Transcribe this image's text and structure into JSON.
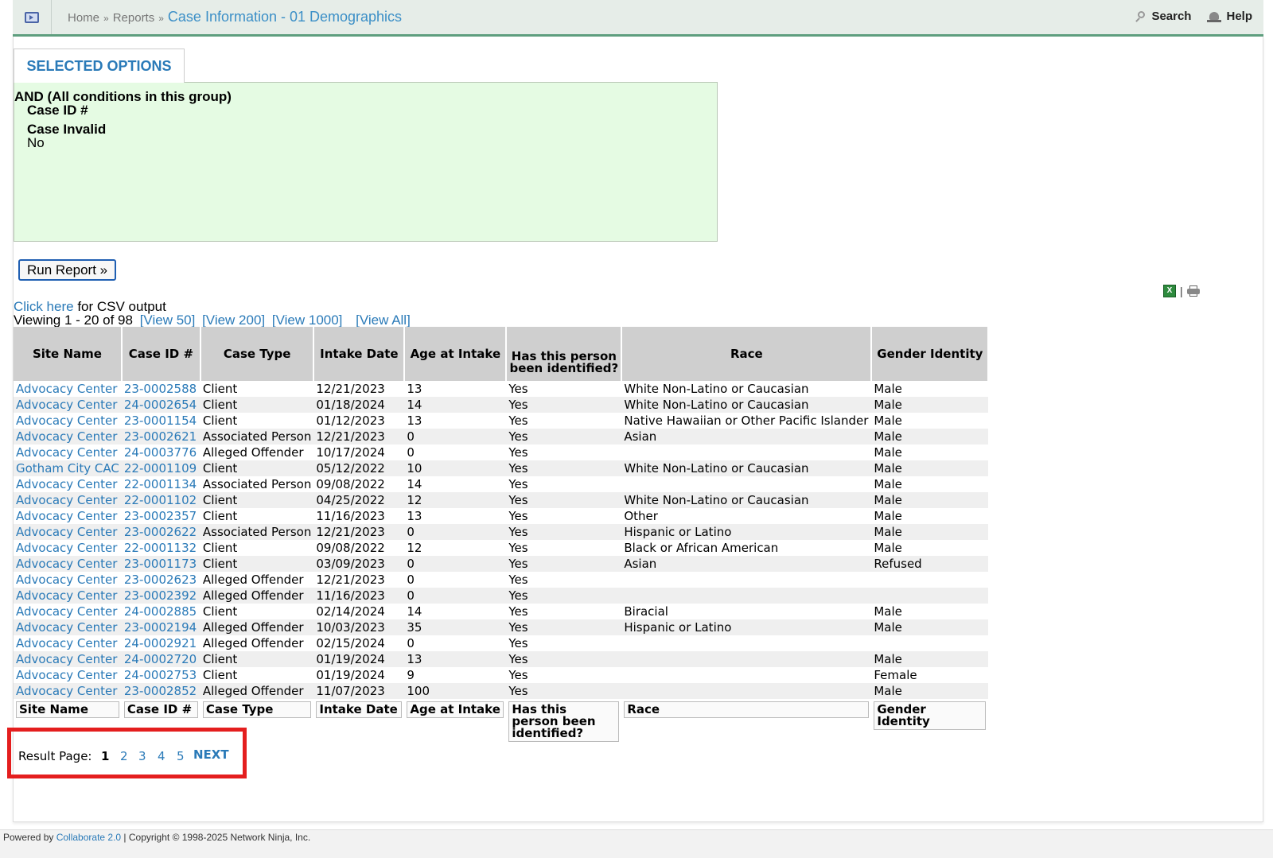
{
  "header": {
    "breadcrumb": [
      "Home",
      "Reports"
    ],
    "breadcrumb_sep": "»",
    "current": "Case Information - 01 Demographics",
    "search_label": "Search",
    "help_label": "Help"
  },
  "options": {
    "tab_label": "SELECTED OPTIONS",
    "group_label": "AND (All conditions in this group)",
    "conditions": [
      {
        "field": "Case ID #",
        "value": ""
      },
      {
        "field": "Case Invalid",
        "value": "No"
      }
    ]
  },
  "run_button": "Run Report »",
  "export": {
    "xls_icon": "excel-icon",
    "print_icon": "print-icon",
    "separator": "|"
  },
  "csv": {
    "link": "Click here",
    "text": " for CSV output"
  },
  "viewing": {
    "text": "Viewing 1 - 20 of 98",
    "links": [
      "[View 50]",
      "[View 200]",
      "[View 1000]",
      "[View All]"
    ]
  },
  "table": {
    "columns": [
      "Site Name",
      "Case ID #",
      "Case Type",
      "Intake Date",
      "Age at Intake",
      "Has this person been identified?",
      "Race",
      "Gender Identity"
    ],
    "rows": [
      [
        "Advocacy Center",
        "23-0002588",
        "Client",
        "12/21/2023",
        "13",
        "Yes",
        "White Non-Latino or Caucasian",
        "Male"
      ],
      [
        "Advocacy Center",
        "24-0002654",
        "Client",
        "01/18/2024",
        "14",
        "Yes",
        "White Non-Latino or Caucasian",
        "Male"
      ],
      [
        "Advocacy Center",
        "23-0001154",
        "Client",
        "01/12/2023",
        "13",
        "Yes",
        "Native Hawaiian or Other Pacific Islander",
        "Male"
      ],
      [
        "Advocacy Center",
        "23-0002621",
        "Associated Person",
        "12/21/2023",
        "0",
        "Yes",
        "Asian",
        "Male"
      ],
      [
        "Advocacy Center",
        "24-0003776",
        "Alleged Offender",
        "10/17/2024",
        "0",
        "Yes",
        "",
        "Male"
      ],
      [
        "Gotham City CAC",
        "22-0001109",
        "Client",
        "05/12/2022",
        "10",
        "Yes",
        "White Non-Latino or Caucasian",
        "Male"
      ],
      [
        "Advocacy Center",
        "22-0001134",
        "Associated Person",
        "09/08/2022",
        "14",
        "Yes",
        "",
        "Male"
      ],
      [
        "Advocacy Center",
        "22-0001102",
        "Client",
        "04/25/2022",
        "12",
        "Yes",
        "White Non-Latino or Caucasian",
        "Male"
      ],
      [
        "Advocacy Center",
        "23-0002357",
        "Client",
        "11/16/2023",
        "13",
        "Yes",
        "Other",
        "Male"
      ],
      [
        "Advocacy Center",
        "23-0002622",
        "Associated Person",
        "12/21/2023",
        "0",
        "Yes",
        "Hispanic or Latino",
        "Male"
      ],
      [
        "Advocacy Center",
        "22-0001132",
        "Client",
        "09/08/2022",
        "12",
        "Yes",
        "Black or African American",
        "Male"
      ],
      [
        "Advocacy Center",
        "23-0001173",
        "Client",
        "03/09/2023",
        "0",
        "Yes",
        "Asian",
        "Refused"
      ],
      [
        "Advocacy Center",
        "23-0002623",
        "Alleged Offender",
        "12/21/2023",
        "0",
        "Yes",
        "",
        ""
      ],
      [
        "Advocacy Center",
        "23-0002392",
        "Alleged Offender",
        "11/16/2023",
        "0",
        "Yes",
        "",
        ""
      ],
      [
        "Advocacy Center",
        "24-0002885",
        "Client",
        "02/14/2024",
        "14",
        "Yes",
        "Biracial",
        "Male"
      ],
      [
        "Advocacy Center",
        "23-0002194",
        "Alleged Offender",
        "10/03/2023",
        "35",
        "Yes",
        "Hispanic or Latino",
        "Male"
      ],
      [
        "Advocacy Center",
        "24-0002921",
        "Alleged Offender",
        "02/15/2024",
        "0",
        "Yes",
        "",
        ""
      ],
      [
        "Advocacy Center",
        "24-0002720",
        "Client",
        "01/19/2024",
        "13",
        "Yes",
        "",
        "Male"
      ],
      [
        "Advocacy Center",
        "24-0002753",
        "Client",
        "01/19/2024",
        "9",
        "Yes",
        "",
        "Female"
      ],
      [
        "Advocacy Center",
        "23-0002852",
        "Alleged Offender",
        "11/07/2023",
        "100",
        "Yes",
        "",
        "Male"
      ]
    ]
  },
  "pager": {
    "label": "Result Page:",
    "current": "1",
    "pages": [
      "2",
      "3",
      "4",
      "5"
    ],
    "next": "NEXT"
  },
  "footer": {
    "powered": "Powered by ",
    "link": "Collaborate 2.0",
    "rest": " | Copyright © 1998-2025 Network Ninja, Inc."
  },
  "colors": {
    "link": "#2a7ab8",
    "header_bg": "#e6ede8",
    "header_border": "#5e9e7e",
    "options_bg": "#e5fbe3",
    "highlight": "#e41e1e"
  }
}
